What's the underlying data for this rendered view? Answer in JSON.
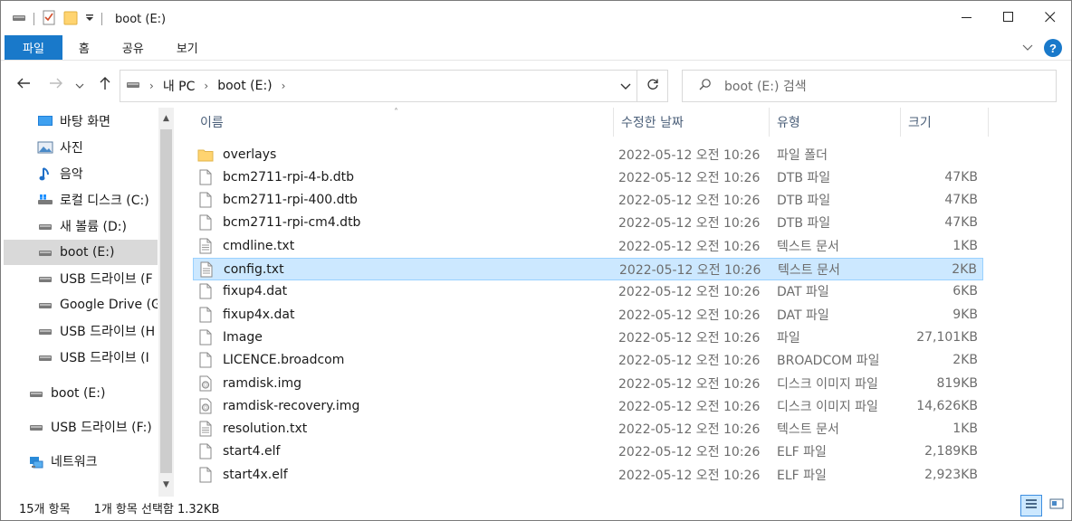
{
  "window": {
    "title": "boot (E:)",
    "minimize_icon": "minimize-icon",
    "maximize_icon": "maximize-icon",
    "close_icon": "close-icon"
  },
  "ribbon": {
    "tabs": [
      {
        "label": "파일",
        "active": true
      },
      {
        "label": "홈"
      },
      {
        "label": "공유"
      },
      {
        "label": "보기"
      }
    ],
    "help_label": "?"
  },
  "address": {
    "crumbs": [
      "내 PC",
      "boot (E:)"
    ],
    "search_placeholder": "boot (E:) 검색"
  },
  "nav": {
    "items": [
      {
        "label": "바탕 화면",
        "icon": "desktop-icon"
      },
      {
        "label": "사진",
        "icon": "pictures-icon"
      },
      {
        "label": "음악",
        "icon": "music-icon"
      },
      {
        "label": "로컬 디스크 (C:)",
        "icon": "windows-drive-icon"
      },
      {
        "label": "새 볼륨 (D:)",
        "icon": "drive-icon"
      },
      {
        "label": "boot (E:)",
        "icon": "drive-icon",
        "selected": true
      },
      {
        "label": "USB 드라이브 (F",
        "icon": "drive-icon"
      },
      {
        "label": "Google Drive (G",
        "icon": "drive-icon"
      },
      {
        "label": "USB 드라이브 (H",
        "icon": "drive-icon"
      },
      {
        "label": "USB 드라이브 (I",
        "icon": "drive-icon"
      },
      {
        "label": "boot (E:)",
        "icon": "drive-icon"
      },
      {
        "label": "USB 드라이브 (F:)",
        "icon": "drive-icon"
      },
      {
        "label": "네트워크",
        "icon": "network-icon"
      }
    ]
  },
  "columns": {
    "name": "이름",
    "date": "수정한 날짜",
    "type": "유형",
    "size": "크기"
  },
  "files": [
    {
      "name": "overlays",
      "date": "2022-05-12 오전 10:26",
      "type": "파일 폴더",
      "size": "",
      "icon": "folder-icon"
    },
    {
      "name": "bcm2711-rpi-4-b.dtb",
      "date": "2022-05-12 오전 10:26",
      "type": "DTB 파일",
      "size": "47KB",
      "icon": "file-icon"
    },
    {
      "name": "bcm2711-rpi-400.dtb",
      "date": "2022-05-12 오전 10:26",
      "type": "DTB 파일",
      "size": "47KB",
      "icon": "file-icon"
    },
    {
      "name": "bcm2711-rpi-cm4.dtb",
      "date": "2022-05-12 오전 10:26",
      "type": "DTB 파일",
      "size": "47KB",
      "icon": "file-icon"
    },
    {
      "name": "cmdline.txt",
      "date": "2022-05-12 오전 10:26",
      "type": "텍스트 문서",
      "size": "1KB",
      "icon": "text-file-icon"
    },
    {
      "name": "config.txt",
      "date": "2022-05-12 오전 10:26",
      "type": "텍스트 문서",
      "size": "2KB",
      "icon": "text-file-icon",
      "selected": true
    },
    {
      "name": "fixup4.dat",
      "date": "2022-05-12 오전 10:26",
      "type": "DAT 파일",
      "size": "6KB",
      "icon": "file-icon"
    },
    {
      "name": "fixup4x.dat",
      "date": "2022-05-12 오전 10:26",
      "type": "DAT 파일",
      "size": "9KB",
      "icon": "file-icon"
    },
    {
      "name": "Image",
      "date": "2022-05-12 오전 10:26",
      "type": "파일",
      "size": "27,101KB",
      "icon": "file-icon"
    },
    {
      "name": "LICENCE.broadcom",
      "date": "2022-05-12 오전 10:26",
      "type": "BROADCOM 파일",
      "size": "2KB",
      "icon": "file-icon"
    },
    {
      "name": "ramdisk.img",
      "date": "2022-05-12 오전 10:26",
      "type": "디스크 이미지 파일",
      "size": "819KB",
      "icon": "disc-image-icon"
    },
    {
      "name": "ramdisk-recovery.img",
      "date": "2022-05-12 오전 10:26",
      "type": "디스크 이미지 파일",
      "size": "14,626KB",
      "icon": "disc-image-icon"
    },
    {
      "name": "resolution.txt",
      "date": "2022-05-12 오전 10:26",
      "type": "텍스트 문서",
      "size": "1KB",
      "icon": "text-file-icon"
    },
    {
      "name": "start4.elf",
      "date": "2022-05-12 오전 10:26",
      "type": "ELF 파일",
      "size": "2,189KB",
      "icon": "file-icon"
    },
    {
      "name": "start4x.elf",
      "date": "2022-05-12 오전 10:26",
      "type": "ELF 파일",
      "size": "2,923KB",
      "icon": "file-icon"
    }
  ],
  "status": {
    "count": "15개 항목",
    "selection": "1개 항목 선택함 1.32KB"
  },
  "colors": {
    "accent": "#1979ca",
    "selected_row": "#cce8ff",
    "selected_border": "#99d1ff"
  }
}
